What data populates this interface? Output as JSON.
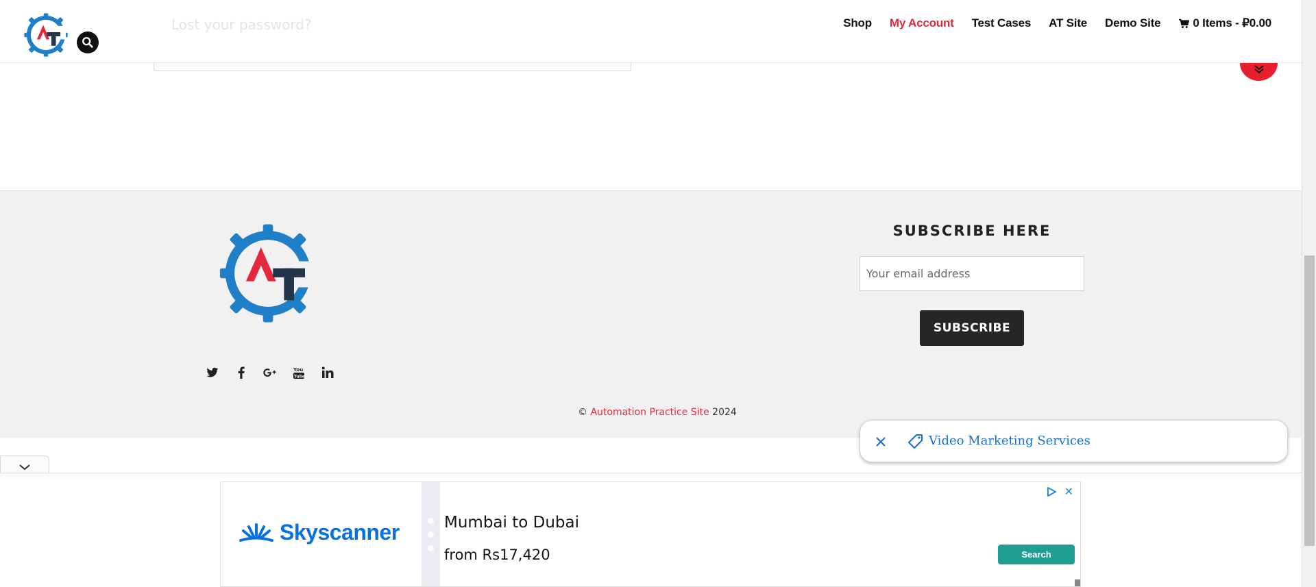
{
  "header": {
    "logo_alt": "AT",
    "nav": [
      {
        "label": "Shop",
        "active": false
      },
      {
        "label": "My Account",
        "active": true
      },
      {
        "label": "Test Cases",
        "active": false
      },
      {
        "label": "AT Site",
        "active": false
      },
      {
        "label": "Demo Site",
        "active": false
      }
    ],
    "cart_label": "0 Items - ₽0.00"
  },
  "content": {
    "lost_password": "Lost your password?"
  },
  "footer": {
    "subscribe_title": "SUBSCRIBE HERE",
    "email_placeholder": "Your email address",
    "subscribe_button": "SUBSCRIBE",
    "social_icons": [
      "twitter-icon",
      "facebook-icon",
      "google-plus-icon",
      "youtube-icon",
      "linkedin-icon"
    ],
    "copyright_symbol": "©",
    "copyright_link": "Automation Practice Site",
    "copyright_year": "2024"
  },
  "ad_toast": {
    "text": "Video Marketing Services"
  },
  "bottom_ad": {
    "brand": "Skyscanner",
    "route": "Mumbai to Dubai",
    "price": "from Rs17,420",
    "button": "Search"
  },
  "colors": {
    "accent_red": "#e4293d",
    "logo_blue": "#1f7fc7",
    "logo_dark": "#233548",
    "link_blue": "#1a6fcc",
    "ad_teal": "#1f9e92"
  }
}
